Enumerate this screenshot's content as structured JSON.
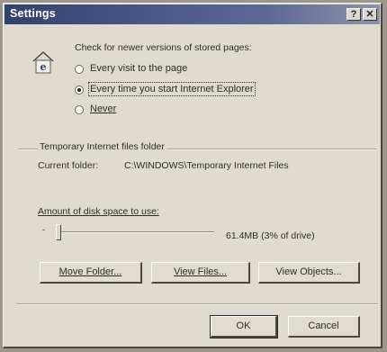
{
  "window": {
    "title": "Settings",
    "help_label": "?",
    "close_label": "✕"
  },
  "check": {
    "heading": "Check for newer versions of stored pages:",
    "options": [
      {
        "label": "Every visit to the page",
        "checked": false
      },
      {
        "label": "Every time you start Internet Explorer",
        "checked": true
      },
      {
        "label": "Never",
        "checked": false
      }
    ]
  },
  "temp_folder": {
    "group_label": "Temporary Internet files folder",
    "current_label": "Current folder:",
    "current_path": "C:\\WINDOWS\\Temporary Internet Files",
    "disk_label": "Amount of disk space to use:",
    "disk_value": "61.4MB (3% of drive)",
    "slider_fraction": 0.03
  },
  "buttons": {
    "move_folder": "Move Folder...",
    "view_files": "View Files...",
    "view_objects": "View Objects...",
    "ok": "OK",
    "cancel": "Cancel"
  },
  "colors": {
    "title_bar": "#33416f",
    "dialog_bg": "#e0dbd0"
  },
  "icons": {
    "ie": "internet-explorer-icon"
  }
}
